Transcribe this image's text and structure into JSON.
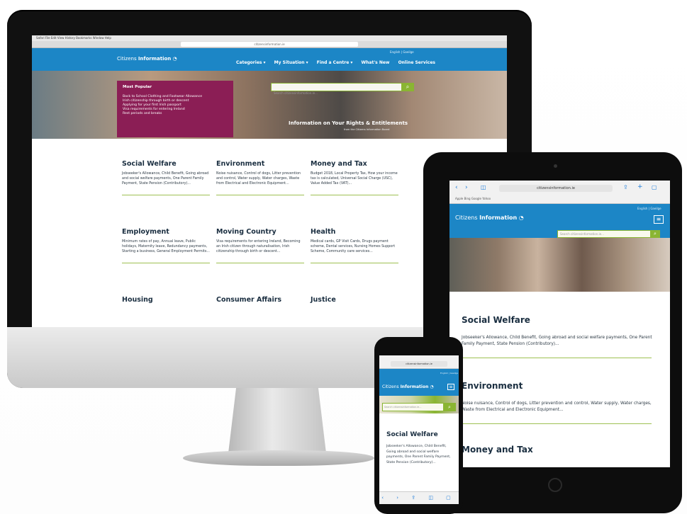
{
  "desktop": {
    "menubar": "Safari  File  Edit  View  History  Bookmarks  Window  Help",
    "url": "citizensinformation.ie",
    "brand": {
      "light": "Citizens ",
      "bold": "Information"
    },
    "lang": "English | Gaeilge",
    "nav": [
      "Categories ▾",
      "My Situation ▾",
      "Find a Centre ▾",
      "What's New",
      "Online Services"
    ],
    "popular": {
      "title": "Most Popular",
      "items": [
        "Back to School Clothing and Footwear Allowance",
        "Irish citizenship through birth or descent",
        "Applying for your first Irish passport",
        "Visa requirements for entering Ireland",
        "Rest periods and breaks"
      ]
    },
    "search_placeholder": "Search citizensinformation.ie...",
    "tagline": "Information on Your Rights & Entitlements",
    "tagline_sub": "from the Citizens Information Board",
    "categories": [
      {
        "title": "Social Welfare",
        "text": "Jobseeker's Allowance, Child Benefit, Going abroad and social welfare payments, One Parent Family Payment, State Pension (Contributory)..."
      },
      {
        "title": "Environment",
        "text": "Noise nuisance, Control of dogs, Litter prevention and control, Water supply, Water charges, Waste from Electrical and Electronic Equipment..."
      },
      {
        "title": "Money and Tax",
        "text": "Budget 2018, Local Property Tax, How your income tax is calculated, Universal Social Charge (USC), Value Added Tax (VAT)..."
      },
      {
        "title": "Employment",
        "text": "Minimum rates of pay, Annual leave, Public holidays, Maternity leave, Redundancy payments, Starting a business, General Employment Permits..."
      },
      {
        "title": "Moving Country",
        "text": "Visa requirements for entering Ireland, Becoming an Irish citizen through naturalisation, Irish citizenship through birth or descent..."
      },
      {
        "title": "Health",
        "text": "Medical cards, GP Visit Cards, Drugs payment scheme, Dental services, Nursing Homes Support Scheme, Community care services..."
      },
      {
        "title": "Housing",
        "text": ""
      },
      {
        "title": "Consumer Affairs",
        "text": ""
      },
      {
        "title": "Justice",
        "text": ""
      }
    ]
  },
  "tablet": {
    "url": "citizensinformation.ie",
    "bookmarks": "Apple   Bing   Google   Yahoo",
    "brand": {
      "light": "Citizens ",
      "bold": "Information"
    },
    "lang": "English | Gaeilge",
    "menu_icon": "≡",
    "search_placeholder": "Search citizensinformation.ie...",
    "categories": [
      {
        "title": "Social Welfare",
        "text": "Jobseeker's Allowance, Child Benefit, Going abroad and social welfare payments, One Parent Family Payment, State Pension (Contributory)..."
      },
      {
        "title": "Environment",
        "text": "Noise nuisance, Control of dogs, Litter prevention and control, Water supply, Water charges, Waste from Electrical and Electronic Equipment..."
      },
      {
        "title": "Money and Tax",
        "text": ""
      }
    ]
  },
  "phone": {
    "url": "citizensinformation.ie",
    "brand": {
      "light": "Citizens ",
      "bold": "Information"
    },
    "lang": "English | Gaeilge",
    "menu_icon": "≡",
    "search_placeholder": "Search citizensinformation.ie...",
    "category": {
      "title": "Social Welfare",
      "text": "Jobseeker's Allowance, Child Benefit, Going abroad and social welfare payments, One Parent Family Payment, State Pension (Contributory)..."
    },
    "toolbar": "‹ › ⇪ ◫ ▢"
  },
  "colors": {
    "brand_blue": "#1c86c6",
    "accent_green": "#8ab532",
    "popular_magenta": "#8b1e55"
  }
}
